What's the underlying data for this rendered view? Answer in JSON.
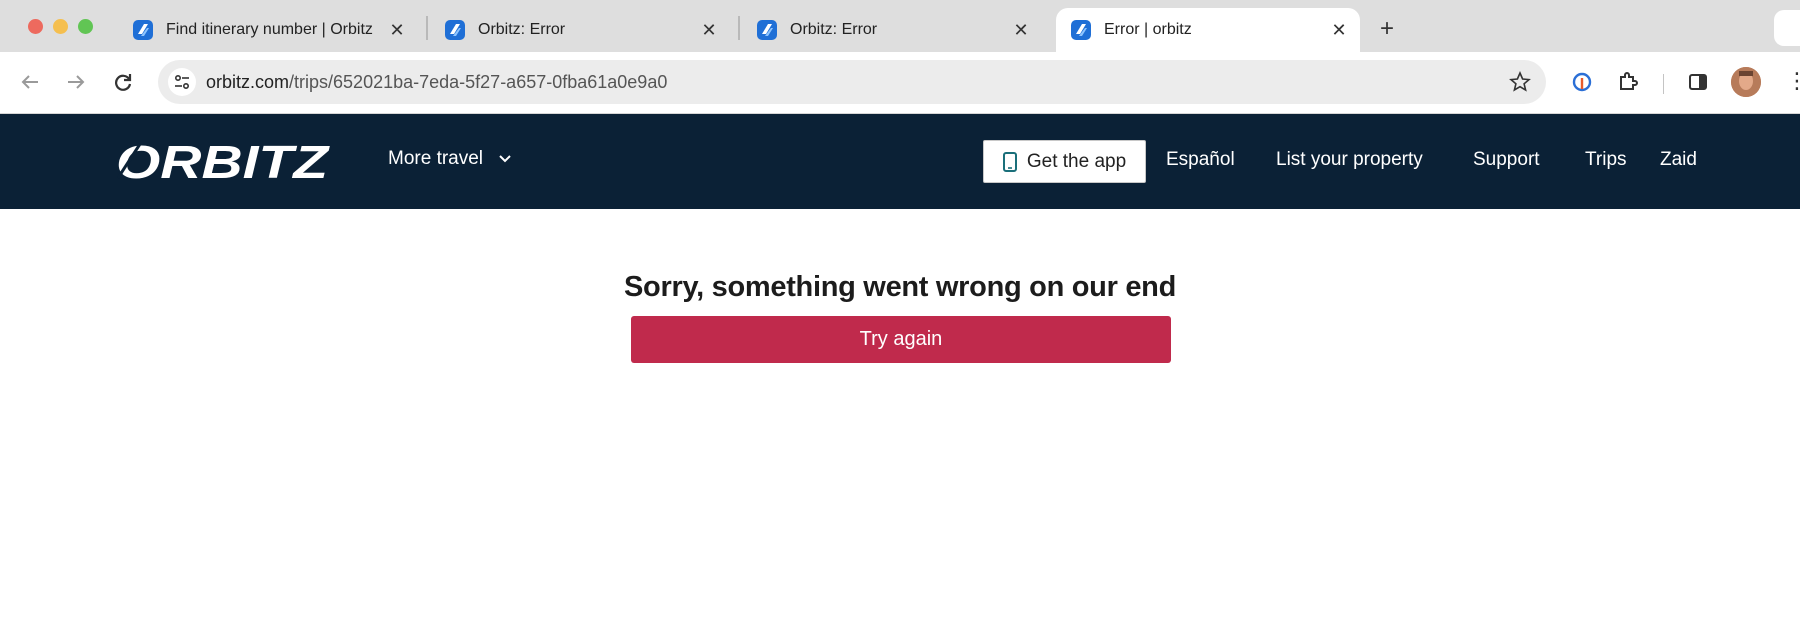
{
  "browser": {
    "tabs": [
      {
        "title": "Find itinerary number | Orbitz",
        "active": false
      },
      {
        "title": "Orbitz: Error",
        "active": false
      },
      {
        "title": "Orbitz: Error",
        "active": false
      },
      {
        "title": "Error | orbitz",
        "active": true
      }
    ],
    "new_tab_icon": "plus-icon",
    "url": {
      "domain": "orbitz.com",
      "path": "/trips/652021ba-7eda-5f27-a657-0fba61a0e9a0"
    }
  },
  "header": {
    "logo_text": "ORBITZ",
    "more_travel": "More travel",
    "get_app": "Get the app",
    "links": {
      "espanol": "Español",
      "list_property": "List your property",
      "support": "Support",
      "trips": "Trips",
      "user": "Zaid"
    }
  },
  "main": {
    "error_title": "Sorry, something went wrong on our end",
    "try_again": "Try again"
  },
  "colors": {
    "header_bg": "#0b2136",
    "button_bg": "#c02a4c",
    "favicon": "#1f6fd6"
  }
}
